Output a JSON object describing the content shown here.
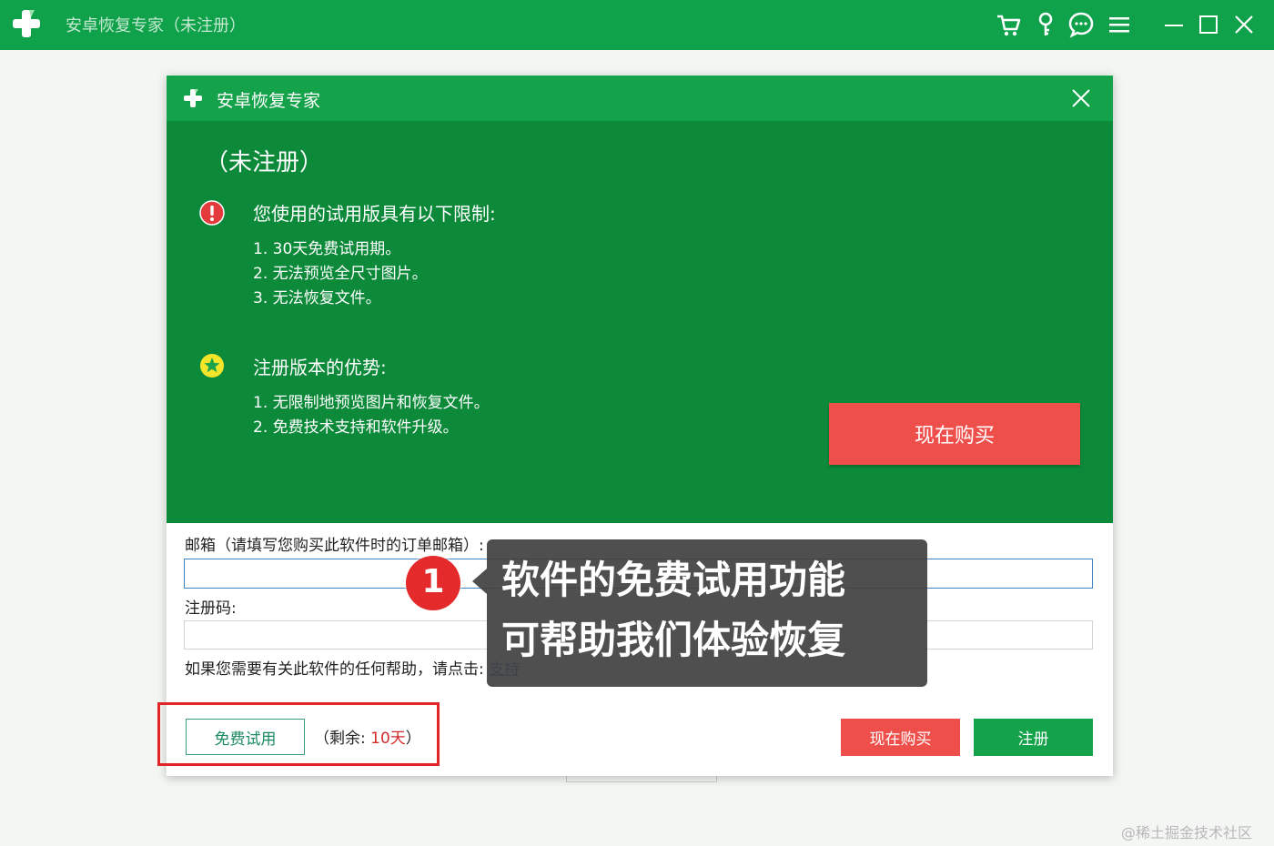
{
  "window": {
    "title": "安卓恢复专家（未注册）"
  },
  "dialog": {
    "title": "安卓恢复专家",
    "status": "（未注册）",
    "trial_limits": {
      "title": "您使用的试用版具有以下限制:",
      "items": [
        "1. 30天免费试用期。",
        "2. 无法预览全尺寸图片。",
        "3. 无法恢复文件。"
      ]
    },
    "advantages": {
      "title": "注册版本的优势:",
      "items": [
        "1. 无限制地预览图片和恢复文件。",
        "2. 免费技术支持和软件升级。"
      ]
    },
    "buy_now_large": "现在购买",
    "email_label": "邮箱（请填写您购买此软件时的订单邮箱）:",
    "email_value": "",
    "code_label": "注册码:",
    "code_value": "",
    "help_text": "如果您需要有关此软件的任何帮助，请点击:",
    "support_link": "支持",
    "free_trial_button": "免费试用",
    "remaining_prefix": "（剩余: ",
    "remaining_days": "10天",
    "remaining_suffix": "）",
    "buy_now_small": "现在购买",
    "register_button": "注册"
  },
  "annotation": {
    "step": "1",
    "line1": "软件的免费试用功能",
    "line2": "可帮助我们体验恢复"
  },
  "watermark": "@稀土掘金技术社区",
  "colors": {
    "titlebar_green": "#10a24a",
    "panel_green": "#0c8a3a",
    "buy_red": "#ee4f4b",
    "highlight_red": "#e32525",
    "link_blue": "#2a62c9"
  },
  "icons": [
    "plus-logo-icon",
    "cart-icon",
    "key-icon",
    "chat-icon",
    "menu-icon",
    "minimize-icon",
    "maximize-icon",
    "close-icon",
    "warning-icon",
    "star-icon"
  ]
}
